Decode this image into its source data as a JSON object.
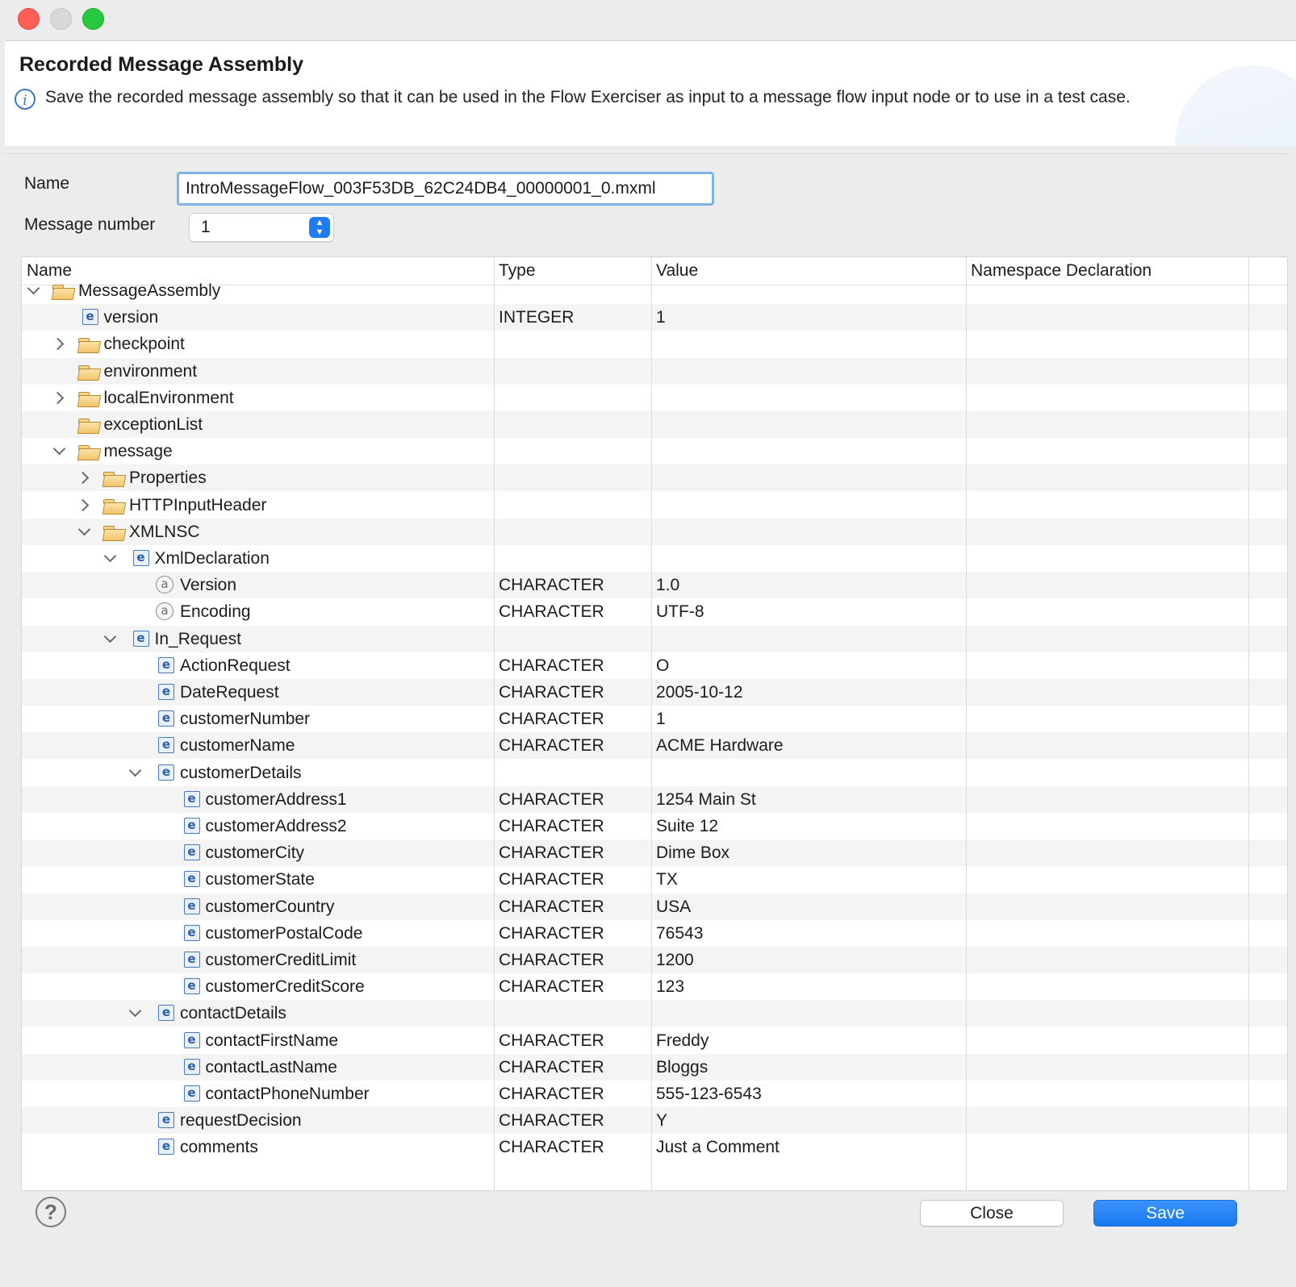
{
  "dialog": {
    "title": "Recorded Message Assembly",
    "description": "Save the recorded message assembly so that it can be used in the Flow Exerciser as input to a message flow input node or to use in a test case.",
    "info_icon": "info-icon"
  },
  "form": {
    "name_label": "Name",
    "name_value": "IntroMessageFlow_003F53DB_62C24DB4_00000001_0.mxml",
    "message_number_label": "Message number",
    "message_number_value": "1"
  },
  "table": {
    "columns": [
      "Name",
      "Type",
      "Value",
      "Namespace Declaration"
    ],
    "rows": [
      {
        "name": "MessageAssembly",
        "type": "",
        "value": "",
        "icon": "folder",
        "twisty": "open",
        "depth": 0
      },
      {
        "name": "version",
        "type": "INTEGER",
        "value": "1",
        "icon": "element",
        "twisty": "none",
        "depth": 1
      },
      {
        "name": "checkpoint",
        "type": "",
        "value": "",
        "icon": "folder",
        "twisty": "closed",
        "depth": 1
      },
      {
        "name": "environment",
        "type": "",
        "value": "",
        "icon": "folder",
        "twisty": "none",
        "depth": 1
      },
      {
        "name": "localEnvironment",
        "type": "",
        "value": "",
        "icon": "folder",
        "twisty": "closed",
        "depth": 1
      },
      {
        "name": "exceptionList",
        "type": "",
        "value": "",
        "icon": "folder",
        "twisty": "none",
        "depth": 1
      },
      {
        "name": "message",
        "type": "",
        "value": "",
        "icon": "folder",
        "twisty": "open",
        "depth": 1
      },
      {
        "name": "Properties",
        "type": "",
        "value": "",
        "icon": "folder",
        "twisty": "closed",
        "depth": 2
      },
      {
        "name": "HTTPInputHeader",
        "type": "",
        "value": "",
        "icon": "folder",
        "twisty": "closed",
        "depth": 2
      },
      {
        "name": "XMLNSC",
        "type": "",
        "value": "",
        "icon": "folder",
        "twisty": "open",
        "depth": 2
      },
      {
        "name": "XmlDeclaration",
        "type": "",
        "value": "",
        "icon": "element",
        "twisty": "open",
        "depth": 3
      },
      {
        "name": "Version",
        "type": "CHARACTER",
        "value": "1.0",
        "icon": "attribute",
        "twisty": "none",
        "depth": 4
      },
      {
        "name": "Encoding",
        "type": "CHARACTER",
        "value": "UTF-8",
        "icon": "attribute",
        "twisty": "none",
        "depth": 4
      },
      {
        "name": "In_Request",
        "type": "",
        "value": "",
        "icon": "element",
        "twisty": "open",
        "depth": 3
      },
      {
        "name": "ActionRequest",
        "type": "CHARACTER",
        "value": "O",
        "icon": "element",
        "twisty": "none",
        "depth": 4
      },
      {
        "name": "DateRequest",
        "type": "CHARACTER",
        "value": "2005-10-12",
        "icon": "element",
        "twisty": "none",
        "depth": 4
      },
      {
        "name": "customerNumber",
        "type": "CHARACTER",
        "value": "1",
        "icon": "element",
        "twisty": "none",
        "depth": 4
      },
      {
        "name": "customerName",
        "type": "CHARACTER",
        "value": "ACME Hardware",
        "icon": "element",
        "twisty": "none",
        "depth": 4
      },
      {
        "name": "customerDetails",
        "type": "",
        "value": "",
        "icon": "element",
        "twisty": "open",
        "depth": 4
      },
      {
        "name": "customerAddress1",
        "type": "CHARACTER",
        "value": "1254 Main St",
        "icon": "element",
        "twisty": "none",
        "depth": 5
      },
      {
        "name": "customerAddress2",
        "type": "CHARACTER",
        "value": "Suite 12",
        "icon": "element",
        "twisty": "none",
        "depth": 5
      },
      {
        "name": "customerCity",
        "type": "CHARACTER",
        "value": "Dime Box",
        "icon": "element",
        "twisty": "none",
        "depth": 5
      },
      {
        "name": "customerState",
        "type": "CHARACTER",
        "value": "TX",
        "icon": "element",
        "twisty": "none",
        "depth": 5
      },
      {
        "name": "customerCountry",
        "type": "CHARACTER",
        "value": "USA",
        "icon": "element",
        "twisty": "none",
        "depth": 5
      },
      {
        "name": "customerPostalCode",
        "type": "CHARACTER",
        "value": "76543",
        "icon": "element",
        "twisty": "none",
        "depth": 5
      },
      {
        "name": "customerCreditLimit",
        "type": "CHARACTER",
        "value": "1200",
        "icon": "element",
        "twisty": "none",
        "depth": 5
      },
      {
        "name": "customerCreditScore",
        "type": "CHARACTER",
        "value": "123",
        "icon": "element",
        "twisty": "none",
        "depth": 5
      },
      {
        "name": "contactDetails",
        "type": "",
        "value": "",
        "icon": "element",
        "twisty": "open",
        "depth": 4
      },
      {
        "name": "contactFirstName",
        "type": "CHARACTER",
        "value": "Freddy",
        "icon": "element",
        "twisty": "none",
        "depth": 5
      },
      {
        "name": "contactLastName",
        "type": "CHARACTER",
        "value": "Bloggs",
        "icon": "element",
        "twisty": "none",
        "depth": 5
      },
      {
        "name": "contactPhoneNumber",
        "type": "CHARACTER",
        "value": "555-123-6543",
        "icon": "element",
        "twisty": "none",
        "depth": 5
      },
      {
        "name": "requestDecision",
        "type": "CHARACTER",
        "value": "Y",
        "icon": "element",
        "twisty": "none",
        "depth": 4
      },
      {
        "name": "comments",
        "type": "CHARACTER",
        "value": "Just a Comment",
        "icon": "element",
        "twisty": "none",
        "depth": 4
      }
    ]
  },
  "footer": {
    "help_icon": "help-icon",
    "close_label": "Close",
    "save_label": "Save"
  },
  "colors": {
    "accent": "#1f7cf3",
    "focus_ring": "#7fb2ea",
    "close_light": "#fe5f57",
    "zoom_light": "#28c840"
  }
}
